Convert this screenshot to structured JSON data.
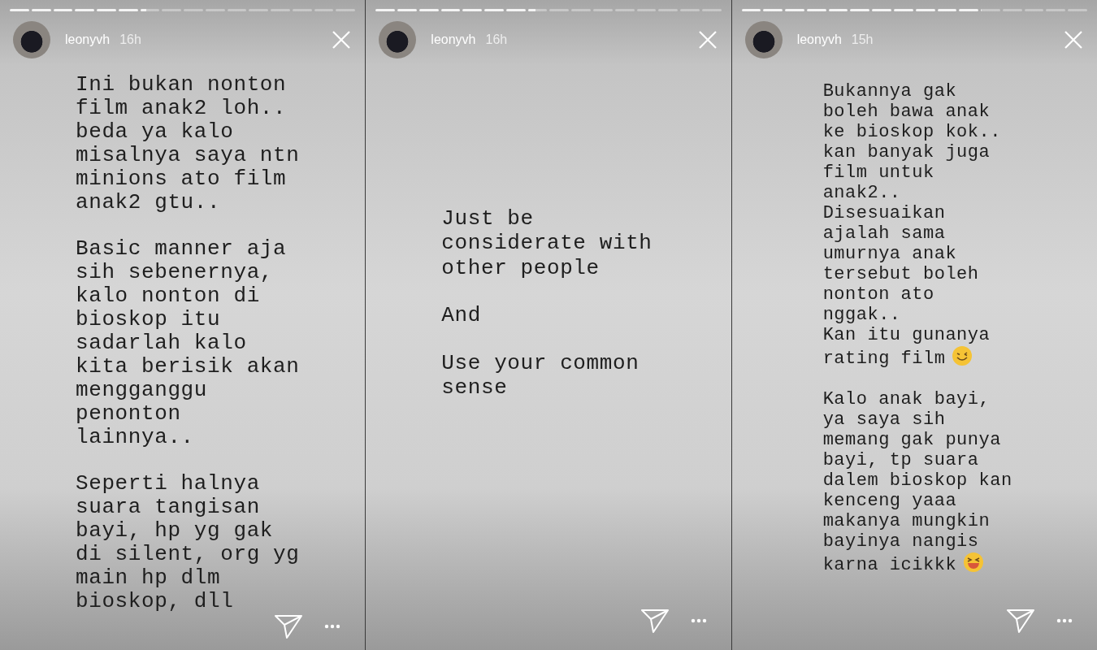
{
  "stories": [
    {
      "username": "leonyvh",
      "time": "16h",
      "kind": "topleft",
      "progress": [
        {
          "level": 1
        },
        {
          "level": 1
        },
        {
          "level": 1
        },
        {
          "level": 1
        },
        {
          "level": 1
        },
        {
          "level": 1
        },
        {
          "level": 0.3
        },
        {
          "level": 0
        },
        {
          "level": 0
        },
        {
          "level": 0
        },
        {
          "level": 0
        },
        {
          "level": 0
        },
        {
          "level": 0
        },
        {
          "level": 0
        },
        {
          "level": 0
        },
        {
          "level": 0
        }
      ],
      "paragraphs": [
        {
          "lines": [
            "Ini bukan nonton",
            "film anak2 loh..",
            "beda ya kalo",
            "misalnya saya ntn",
            "minions ato film",
            "anak2 gtu.."
          ]
        },
        {
          "lines": [
            "Basic manner aja",
            "sih sebenernya,",
            "kalo nonton di",
            "bioskop itu",
            "sadarlah kalo",
            "kita berisik akan",
            "mengganggu",
            "penonton",
            "lainnya.."
          ]
        },
        {
          "lines": [
            "Seperti halnya",
            "suara tangisan",
            "bayi, hp yg gak",
            "di silent, org yg",
            "main hp dlm",
            "bioskop, dll"
          ]
        }
      ]
    },
    {
      "username": "leonyvh",
      "time": "16h",
      "kind": "centered",
      "progress": [
        {
          "level": 1
        },
        {
          "level": 1
        },
        {
          "level": 1
        },
        {
          "level": 1
        },
        {
          "level": 1
        },
        {
          "level": 1
        },
        {
          "level": 1
        },
        {
          "level": 0.4
        },
        {
          "level": 0
        },
        {
          "level": 0
        },
        {
          "level": 0
        },
        {
          "level": 0
        },
        {
          "level": 0
        },
        {
          "level": 0
        },
        {
          "level": 0
        },
        {
          "level": 0
        }
      ],
      "paragraphs": [
        {
          "lines": [
            "Just be",
            "considerate with",
            "other people"
          ]
        },
        {
          "lines": [
            "And"
          ]
        },
        {
          "lines": [
            "Use your common",
            "sense"
          ]
        }
      ]
    },
    {
      "username": "leonyvh",
      "time": "15h",
      "kind": "compact",
      "progress": [
        {
          "level": 1
        },
        {
          "level": 1
        },
        {
          "level": 1
        },
        {
          "level": 1
        },
        {
          "level": 1
        },
        {
          "level": 1
        },
        {
          "level": 1
        },
        {
          "level": 1
        },
        {
          "level": 1
        },
        {
          "level": 1
        },
        {
          "level": 1
        },
        {
          "level": 0.05
        },
        {
          "level": 0
        },
        {
          "level": 0
        },
        {
          "level": 0
        },
        {
          "level": 0
        }
      ],
      "paragraphs": [
        {
          "lines": [
            "Bukannya gak",
            "boleh bawa anak",
            "ke bioskop kok..",
            "kan banyak juga",
            "film untuk",
            "anak2..",
            "Disesuaikan",
            "ajalah sama",
            "umurnya anak",
            "tersebut boleh",
            "nonton ato",
            "nggak..",
            "Kan itu gunanya",
            "rating film"
          ],
          "kind": "winkend"
        },
        {
          "lines": [
            "Kalo anak bayi,",
            "ya saya sih",
            "memang gak punya",
            "bayi, tp suara",
            "dalem bioskop kan",
            "kenceng yaaa",
            "makanya mungkin",
            "bayinya nangis",
            "karna icikkk"
          ],
          "kind": "laughend"
        }
      ]
    }
  ]
}
